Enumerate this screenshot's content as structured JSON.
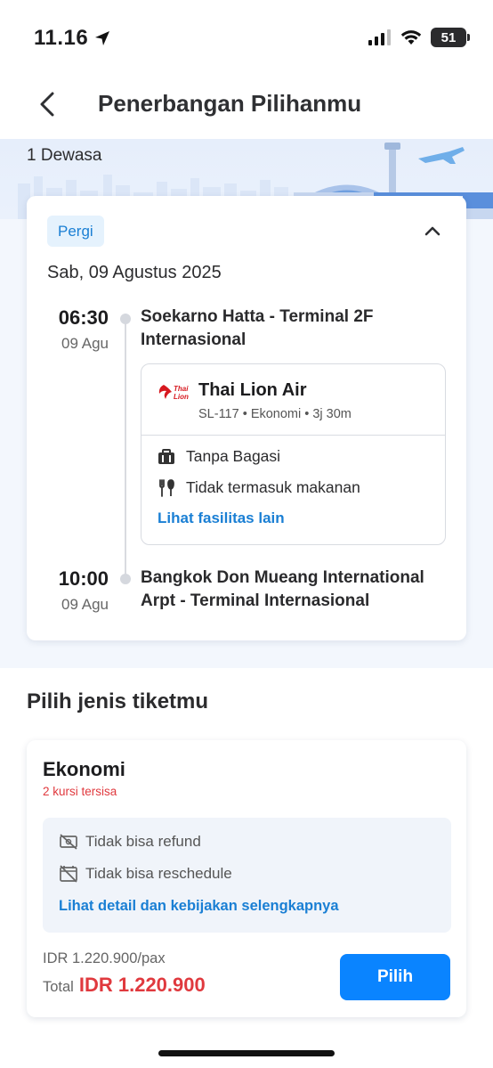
{
  "status_bar": {
    "time": "11.16",
    "battery": "51"
  },
  "header": {
    "title": "Penerbangan Pilihanmu"
  },
  "passenger": "1 Dewasa",
  "flight": {
    "direction_badge": "Pergi",
    "date": "Sab, 09 Agustus 2025",
    "departure": {
      "time": "06:30",
      "date": "09 Agu",
      "airport": "Soekarno Hatta - Terminal 2F Internasional"
    },
    "arrival": {
      "time": "10:00",
      "date": "09 Agu",
      "airport": "Bangkok Don Mueang International Arpt - Terminal Internasional"
    },
    "airline": {
      "logo_text_1": "Thai",
      "logo_text_2": "Lion",
      "name": "Thai Lion Air",
      "meta": "SL-117 • Ekonomi • 3j 30m"
    },
    "facilities": [
      {
        "icon": "baggage-icon",
        "label": "Tanpa Bagasi"
      },
      {
        "icon": "meal-icon",
        "label": "Tidak termasuk makanan"
      }
    ],
    "facilities_link": "Lihat fasilitas lain"
  },
  "ticket_section": {
    "title": "Pilih jenis tiketmu",
    "class_name": "Ekonomi",
    "seats_left": "2 kursi tersisa",
    "policies": [
      {
        "icon": "no-refund-icon",
        "label": "Tidak bisa refund"
      },
      {
        "icon": "no-reschedule-icon",
        "label": "Tidak bisa reschedule"
      }
    ],
    "policy_link": "Lihat detail dan kebijakan selengkapnya",
    "price_per_pax": "IDR 1.220.900/pax",
    "total_label": "Total",
    "total_value": "IDR 1.220.900",
    "choose_button": "Pilih"
  },
  "colors": {
    "accent": "#0a84ff",
    "link": "#1a7fd4",
    "price": "#e0393e"
  }
}
